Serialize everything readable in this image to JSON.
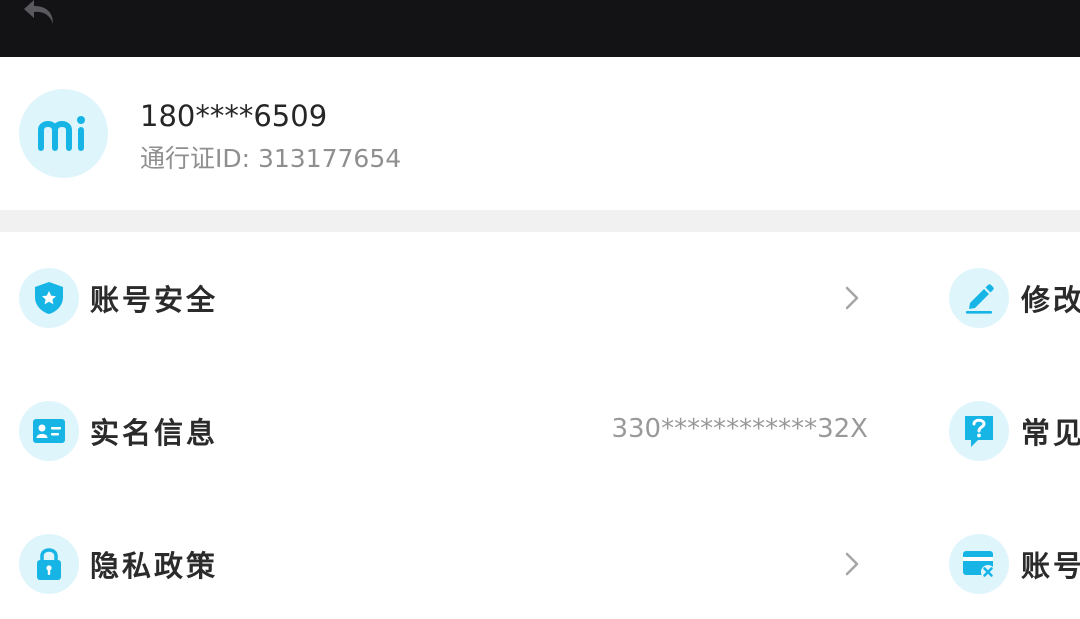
{
  "header": {
    "back_icon": "back-arrow-icon"
  },
  "profile": {
    "avatar_logo": "mi",
    "phone": "180****6509",
    "pass_id": "通行证ID: 313177654"
  },
  "menu_left": [
    {
      "label": "账号安全",
      "icon": "shield-star-icon",
      "value": "",
      "has_chevron": true
    },
    {
      "label": "实名信息",
      "icon": "id-card-icon",
      "value": "330************32X",
      "has_chevron": false
    },
    {
      "label": "隐私政策",
      "icon": "lock-icon",
      "value": "",
      "has_chevron": true
    }
  ],
  "menu_right": [
    {
      "label": "修改",
      "icon": "pencil-edit-icon"
    },
    {
      "label": "常见",
      "icon": "question-mark-icon"
    },
    {
      "label": "账号",
      "icon": "account-card-x-icon"
    }
  ],
  "colors": {
    "accent": "#16b5e6",
    "icon_bg": "#dff5fc",
    "topbar": "#131316",
    "divider": "#f1f1f1"
  }
}
